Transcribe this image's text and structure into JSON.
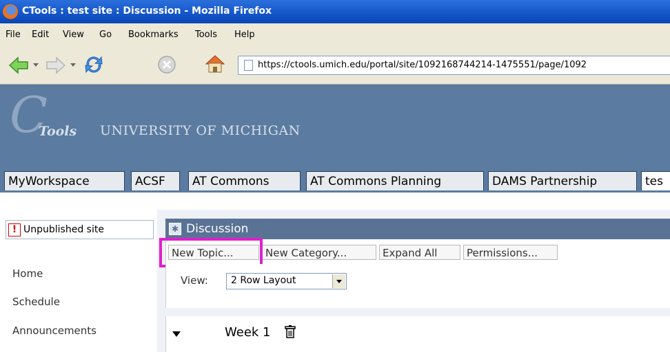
{
  "window": {
    "title": "CTools : test site : Discussion - Mozilla Firefox"
  },
  "menu": {
    "items": [
      "File",
      "Edit",
      "View",
      "Go",
      "Bookmarks",
      "Tools",
      "Help"
    ]
  },
  "toolbar": {
    "url": "https://ctools.umich.edu/portal/site/1092168744214-1475551/page/1092"
  },
  "header": {
    "logo_c": "C",
    "logo_tools": "Tools",
    "university": "UNIVERSITY OF MICHIGAN"
  },
  "tabs": [
    "MyWorkspace",
    "ACSF",
    "AT Commons",
    "AT Commons Planning",
    "DAMS Partnership",
    "tes"
  ],
  "sidebar": {
    "unpublished_label": "Unpublished site",
    "items": [
      "Home",
      "Schedule",
      "Announcements"
    ]
  },
  "tool": {
    "title": "Discussion",
    "buttons": [
      "New Topic...",
      "New Category...",
      "Expand All",
      "Permissions..."
    ],
    "view_label": "View:",
    "view_selected": "2 Row Layout",
    "category": "Week 1"
  },
  "colors": {
    "highlight": "#e01fd0",
    "header_bg": "#5b7ba0",
    "tool_title_bg": "#5a7395"
  }
}
